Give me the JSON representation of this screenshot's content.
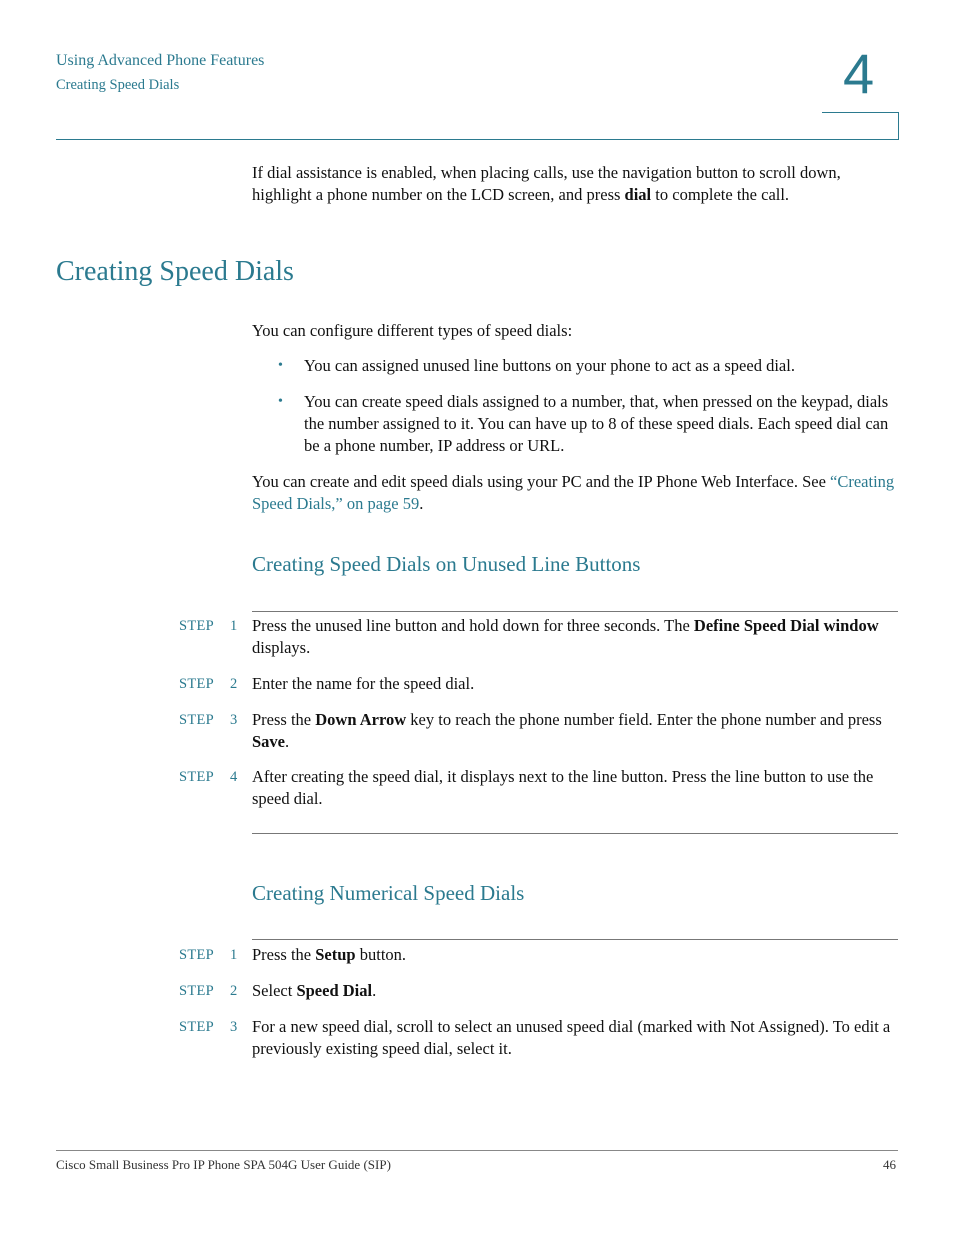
{
  "header": {
    "chapter_title": "Using Advanced Phone Features",
    "section_title": "Creating Speed Dials",
    "chapter_number": "4"
  },
  "intro": {
    "text_before": "If dial assistance is enabled, when placing calls, use the navigation button to scroll down, highlight a phone number on the LCD screen, and press ",
    "bold": "dial",
    "text_after": " to complete the call."
  },
  "section": {
    "heading": "Creating Speed Dials",
    "lead": "You can configure different types of speed dials:",
    "bullets": [
      "You can assigned unused line buttons on your phone to act as a speed dial.",
      "You can create speed dials assigned to a number, that, when pressed on the keypad, dials the number assigned to it. You can have up to 8 of these speed dials. Each speed dial can be a phone number, IP address or URL."
    ],
    "bullet_glyph": "•",
    "closing_text": "You can create and edit speed dials using your PC and the IP Phone Web Interface. See ",
    "closing_link": "“Creating Speed Dials,” on page 59",
    "closing_end": "."
  },
  "subsection1": {
    "heading": "Creating Speed Dials on Unused Line Buttons",
    "step_label": "STEP",
    "steps": [
      {
        "num": "1",
        "t1": "Press the unused line button and hold down for three seconds. The ",
        "b1": "Define Speed Dial window",
        "t2": " displays.",
        "b2": "",
        "t3": ""
      },
      {
        "num": "2",
        "t1": "Enter the name for the speed dial.",
        "b1": "",
        "t2": "",
        "b2": "",
        "t3": ""
      },
      {
        "num": "3",
        "t1": "Press the ",
        "b1": "Down Arrow",
        "t2": " key to reach the phone number field. Enter the phone number and press ",
        "b2": "Save",
        "t3": "."
      },
      {
        "num": "4",
        "t1": "After creating the speed dial, it displays next to the line button. Press the line button to use the speed dial.",
        "b1": "",
        "t2": "",
        "b2": "",
        "t3": ""
      }
    ]
  },
  "subsection2": {
    "heading": "Creating Numerical Speed Dials",
    "step_label": "STEP",
    "steps": [
      {
        "num": "1",
        "t1": "Press the ",
        "b1": "Setup",
        "t2": " button.",
        "b2": "",
        "t3": ""
      },
      {
        "num": "2",
        "t1": "Select ",
        "b1": "Speed Dial",
        "t2": ".",
        "b2": "",
        "t3": ""
      },
      {
        "num": "3",
        "t1": "For a new speed dial, scroll to select an unused speed dial (marked with Not Assigned). To edit a previously existing speed dial, select it.",
        "b1": "",
        "t2": "",
        "b2": "",
        "t3": ""
      }
    ]
  },
  "footer": {
    "guide_title": "Cisco Small Business Pro IP Phone SPA 504G User Guide (SIP)",
    "page_number": "46"
  }
}
